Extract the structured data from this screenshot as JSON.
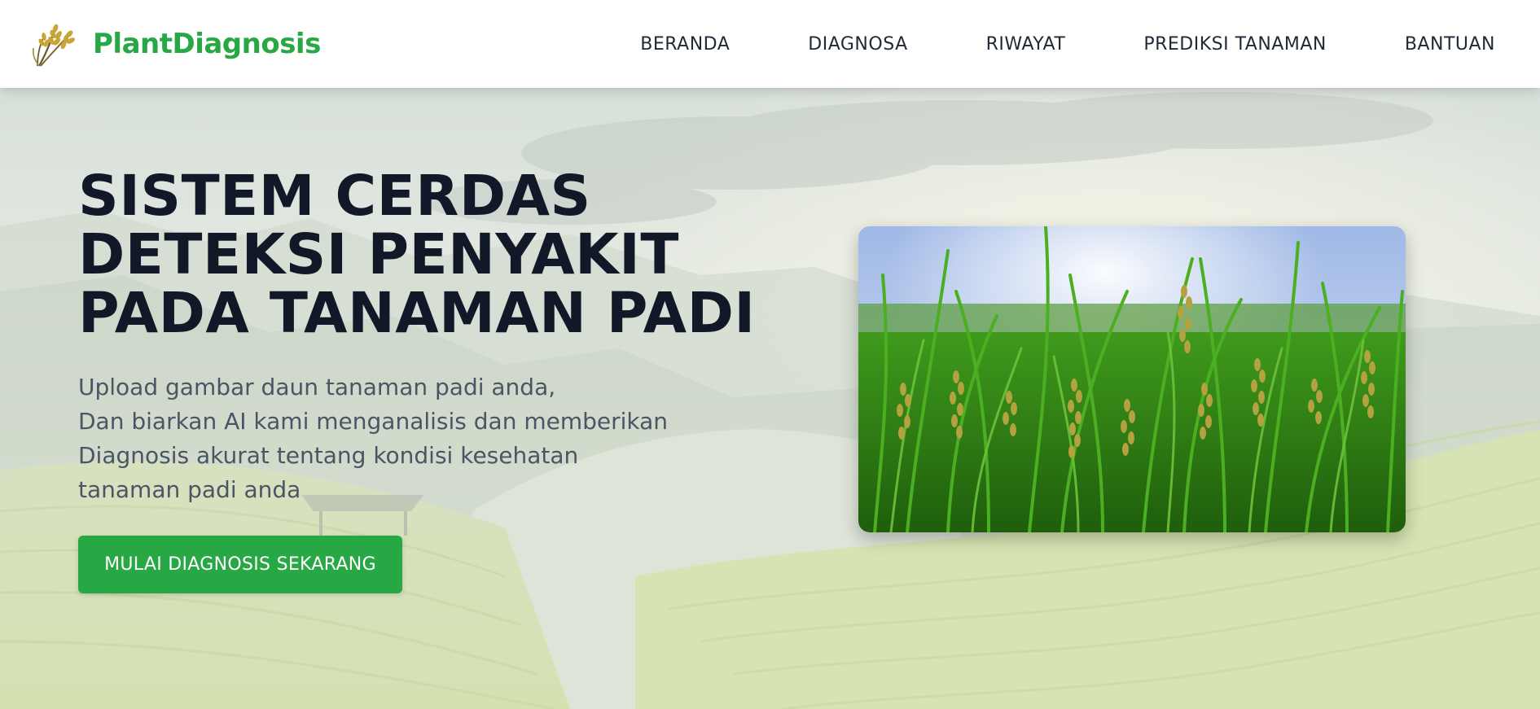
{
  "brand": {
    "name": "PlantDiagnosis",
    "logo_icon": "rice-plant-icon"
  },
  "nav": {
    "items": [
      {
        "label": "BERANDA"
      },
      {
        "label": "DIAGNOSA"
      },
      {
        "label": "RIWAYAT"
      },
      {
        "label": "PREDIKSI TANAMAN"
      },
      {
        "label": "BANTUAN"
      }
    ]
  },
  "hero": {
    "title": "SISTEM CERDAS\nDETEKSI PENYAKIT\nPADA TANAMAN PADI",
    "description": "Upload gambar daun tanaman padi anda,\nDan biarkan AI kami menganalisis dan memberikan\nDiagnosis akurat tentang kondisi kesehatan\ntanaman padi anda",
    "cta_label": "MULAI DIAGNOSIS SEKARANG",
    "image_subject": "rice-field-photo"
  },
  "colors": {
    "accent": "#28a745",
    "title_text": "#111827",
    "body_text": "#4b5563",
    "nav_text": "#1f2937"
  }
}
